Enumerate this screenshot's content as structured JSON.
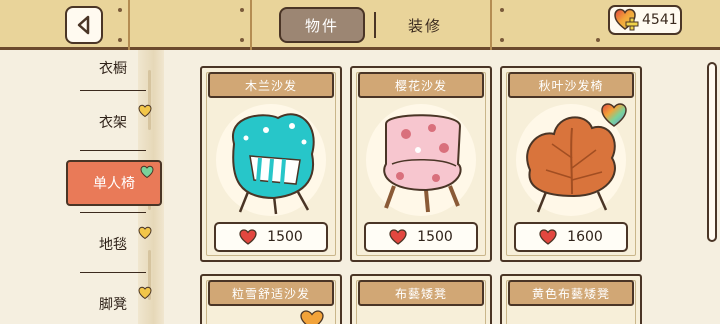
{
  "header": {
    "back_icon": "back-arrow-icon",
    "tabs": [
      {
        "label": "物件",
        "active": true
      },
      {
        "label": "装修",
        "active": false
      }
    ],
    "currency": {
      "icon": "rainbow-heart-plus-icon",
      "value": "4541"
    }
  },
  "sidebar": {
    "items": [
      {
        "label": "衣橱",
        "selected": false
      },
      {
        "label": "衣架",
        "selected": false
      },
      {
        "label": "单人椅",
        "selected": true
      },
      {
        "label": "地毯",
        "selected": false
      },
      {
        "label": "脚凳",
        "selected": false
      }
    ]
  },
  "catalog": {
    "items": [
      {
        "name": "木兰沙发",
        "price": "1500",
        "image": "teal-armchair",
        "colors": {
          "main": "#27c6c9",
          "accent": "#ffffff"
        }
      },
      {
        "name": "樱花沙发",
        "price": "1500",
        "image": "pink-armchair",
        "colors": {
          "main": "#f7c6cf",
          "accent": "#d9707c"
        }
      },
      {
        "name": "秋叶沙发椅",
        "price": "1600",
        "image": "leaf-armchair",
        "colors": {
          "main": "#d9743c",
          "accent": "#a24e22"
        }
      },
      {
        "name": "粒雪舒适沙发",
        "price": "",
        "image": "",
        "colors": {}
      },
      {
        "name": "布藝矮凳",
        "price": "",
        "image": "",
        "colors": {}
      },
      {
        "name": "黄色布藝矮凳",
        "price": "",
        "image": "",
        "colors": {}
      }
    ]
  },
  "colors": {
    "wood": "#e9d49a",
    "outline": "#4a3526",
    "selected_tab": "#9c8673",
    "selected_category": "#e97a58",
    "card_title": "#d1a775",
    "heart": "#e2473f"
  }
}
